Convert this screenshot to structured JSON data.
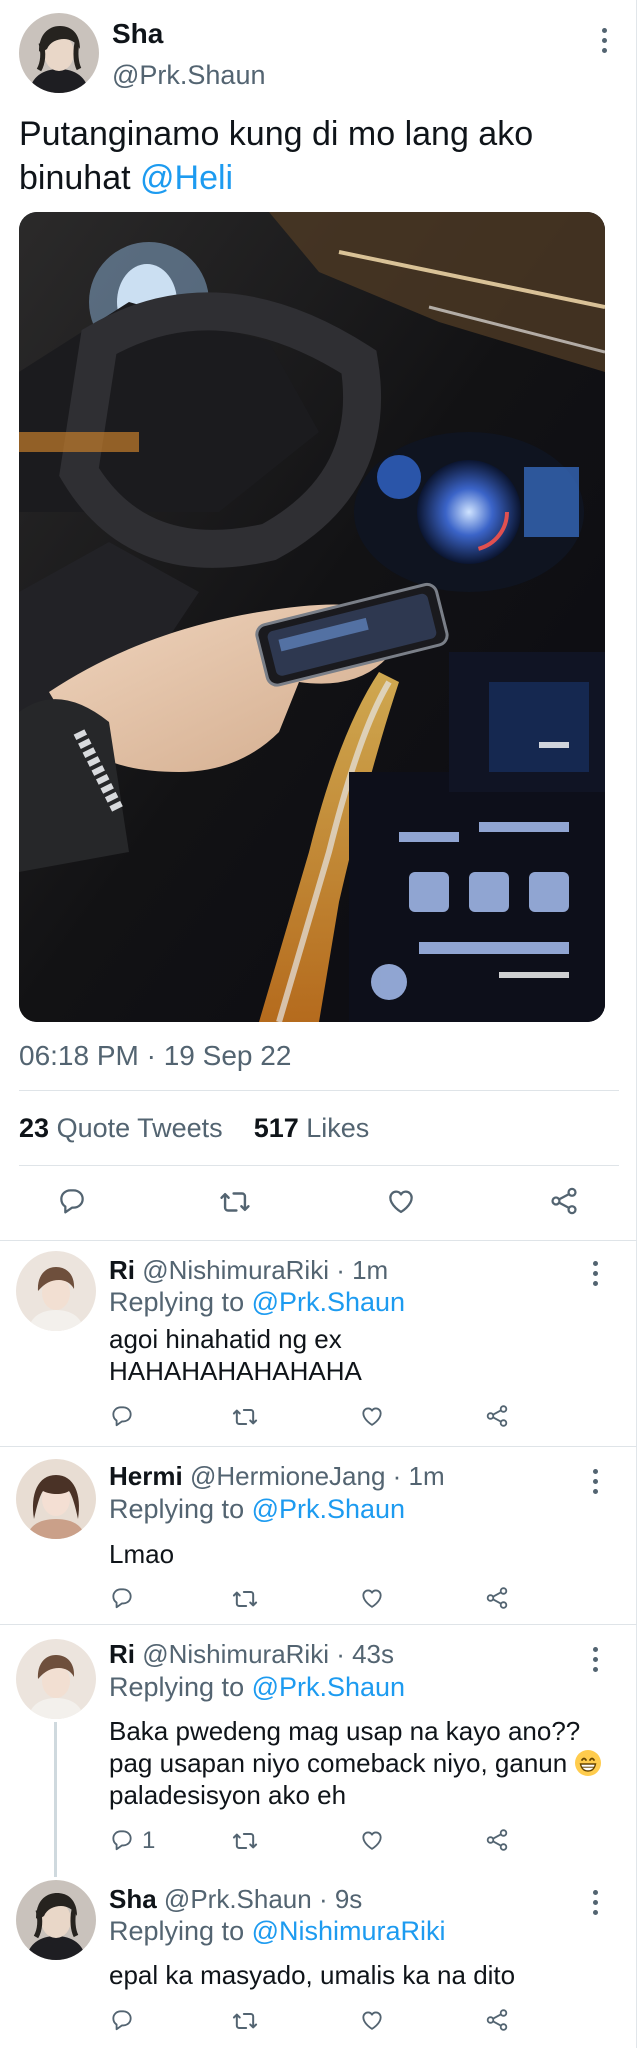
{
  "main_tweet": {
    "display_name": "Sha",
    "handle": "@Prk.Shaun",
    "text": "Putanginamo kung di mo lang ako binuhat ",
    "mention": "@Heli",
    "timestamp": "06:18 PM · 19 Sep 22",
    "quote_tweets_count": "23",
    "quote_tweets_label": "Quote Tweets",
    "likes_count": "517",
    "likes_label": "Likes",
    "media_description": "car-interior-photo"
  },
  "replies": [
    {
      "display_name": "Ri",
      "handle_time": "@NishimuraRiki · 1m",
      "replying_label": "Replying to ",
      "replying_to": "@Prk.Shaun",
      "text": "agoi hinahatid ng ex HAHAHAHAHAHAHA",
      "reply_count": ""
    },
    {
      "display_name": "Hermi",
      "handle_time": "@HermioneJang · 1m",
      "replying_label": "Replying to ",
      "replying_to": "@Prk.Shaun",
      "text": "Lmao",
      "reply_count": ""
    },
    {
      "display_name": "Ri",
      "handle_time": "@NishimuraRiki · 43s",
      "replying_label": "Replying to ",
      "replying_to": "@Prk.Shaun",
      "text_before_emoji": "Baka pwedeng mag usap na kayo ano?? pag usapan niyo comeback niyo, ganun ",
      "text_after_emoji": " paladesisyon ako eh",
      "reply_count": "1"
    },
    {
      "display_name": "Sha",
      "handle_time": "@Prk.Shaun · 9s",
      "replying_label": "Replying to ",
      "replying_to": "@NishimuraRiki",
      "text": "epal ka masyado, umalis ka na dito",
      "reply_count": ""
    }
  ],
  "icons": {
    "reply": "reply-icon",
    "retweet": "retweet-icon",
    "like": "heart-icon",
    "share": "share-icon",
    "more": "more-options-icon",
    "emoji": "grinning-face-emoji"
  },
  "colors": {
    "accent": "#1d9bf0",
    "secondary_text": "#536471",
    "primary_text": "#0f1419",
    "divider": "#dfe4e8"
  }
}
